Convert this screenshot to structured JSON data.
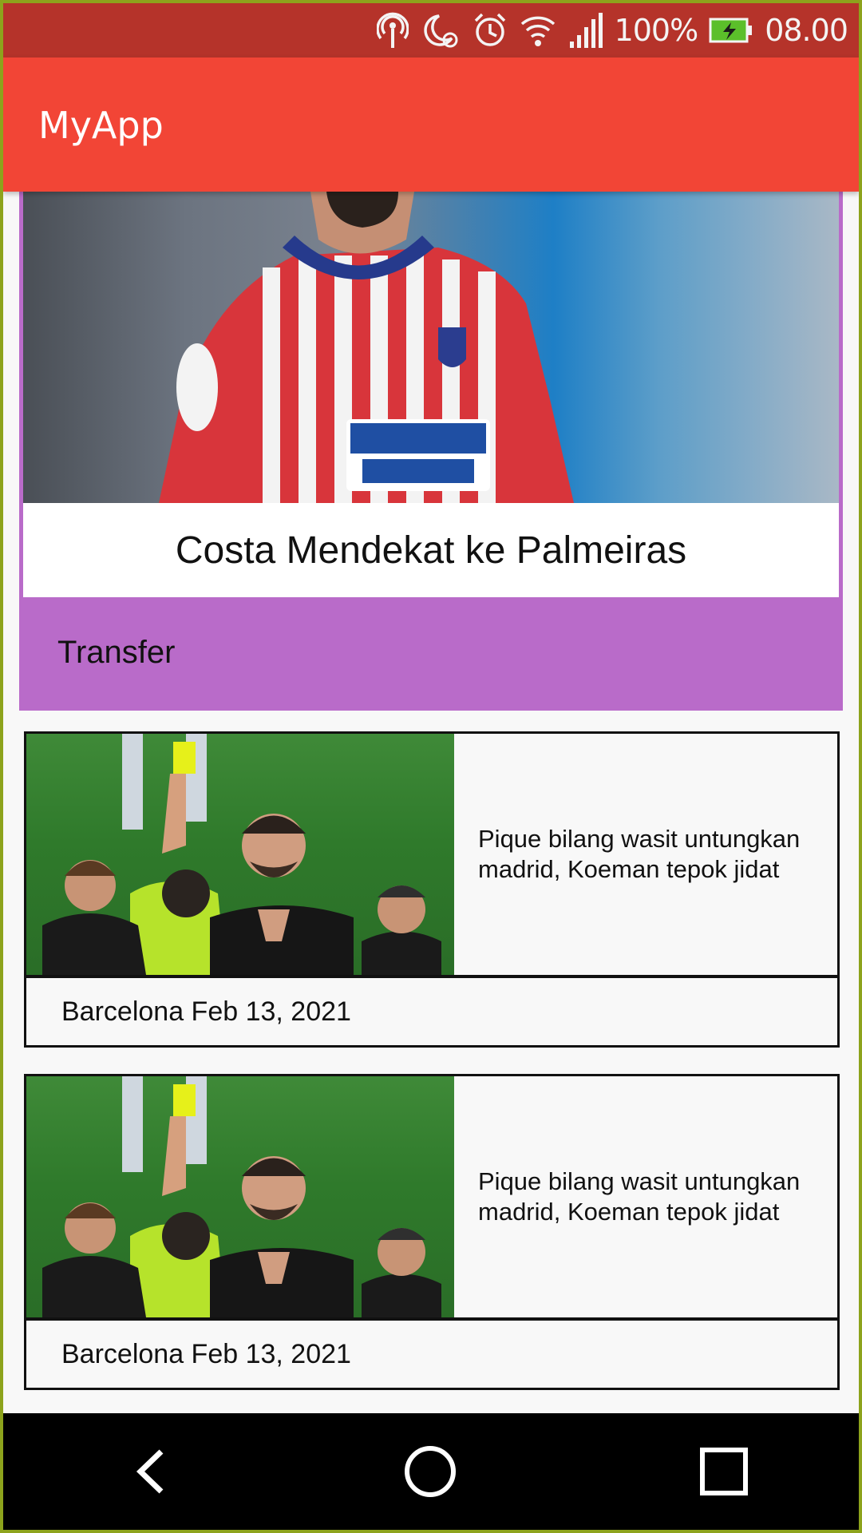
{
  "status_bar": {
    "battery_percent": "100%",
    "time": "08.00",
    "icons": [
      "hotspot-icon",
      "do-not-disturb-icon",
      "alarm-icon",
      "wifi-icon",
      "signal-icon",
      "battery-charging-icon"
    ]
  },
  "app_bar": {
    "title": "MyApp"
  },
  "featured": {
    "title": "Costa Mendekat ke Palmeiras",
    "category": "Transfer",
    "accent_color": "#b96bc9"
  },
  "news": [
    {
      "headline": "Pique bilang wasit untungkan madrid, Koeman tepok jidat",
      "meta": "Barcelona Feb 13, 2021"
    },
    {
      "headline": "Pique bilang wasit untungkan madrid, Koeman tepok jidat",
      "meta": "Barcelona Feb 13, 2021"
    }
  ],
  "nav_bar": {
    "icons": [
      "back-icon",
      "home-icon",
      "recents-icon"
    ]
  },
  "colors": {
    "status_bar": "#b5332a",
    "app_bar": "#f24536",
    "nav_bar": "#000000"
  }
}
